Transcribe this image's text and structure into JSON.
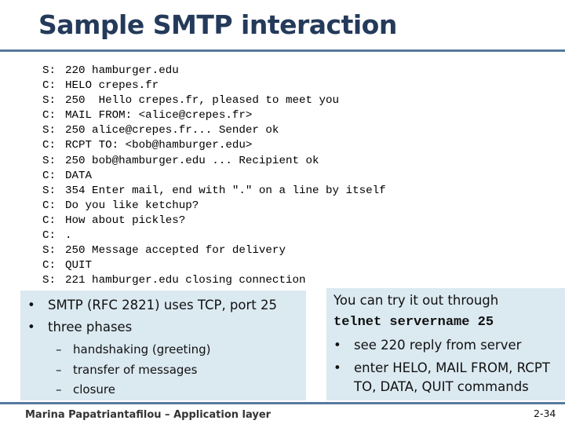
{
  "title": "Sample SMTP interaction",
  "transcript": [
    {
      "who": "S:",
      "text": "220 hamburger.edu"
    },
    {
      "who": "C:",
      "text": "HELO crepes.fr"
    },
    {
      "who": "S:",
      "text": "250  Hello crepes.fr, pleased to meet you"
    },
    {
      "who": "C:",
      "text": "MAIL FROM: <alice@crepes.fr>"
    },
    {
      "who": "S:",
      "text": "250 alice@crepes.fr... Sender ok"
    },
    {
      "who": "C:",
      "text": "RCPT TO: <bob@hamburger.edu>"
    },
    {
      "who": "S:",
      "text": "250 bob@hamburger.edu ... Recipient ok"
    },
    {
      "who": "C:",
      "text": "DATA"
    },
    {
      "who": "S:",
      "text": "354 Enter mail, end with \".\" on a line by itself"
    },
    {
      "who": "C:",
      "text": "Do you like ketchup?"
    },
    {
      "who": "C:",
      "text": "How about pickles?"
    },
    {
      "who": "C:",
      "text": "."
    },
    {
      "who": "S:",
      "text": "250 Message accepted for delivery"
    },
    {
      "who": "C:",
      "text": "QUIT"
    },
    {
      "who": "S:",
      "text": "221 hamburger.edu closing connection"
    }
  ],
  "left_box": {
    "bullets": [
      "SMTP (RFC 2821) uses TCP, port 25",
      "three phases"
    ],
    "sub_bullets": [
      "handshaking (greeting)",
      "transfer of messages",
      "closure"
    ],
    "bullet_char": "•",
    "dash_char": "–"
  },
  "right_box": {
    "intro": "You can try it out through",
    "command": "telnet servername 25",
    "bullets": [
      "see 220 reply from server",
      "enter HELO, MAIL FROM, RCPT",
      "TO, DATA, QUIT commands"
    ]
  },
  "footer": "Marina Papatriantafilou –  Application layer",
  "page_number": "2-34",
  "colors": {
    "title": "#243a5a",
    "rule": "#56799e",
    "box": "#dbe9f1"
  }
}
